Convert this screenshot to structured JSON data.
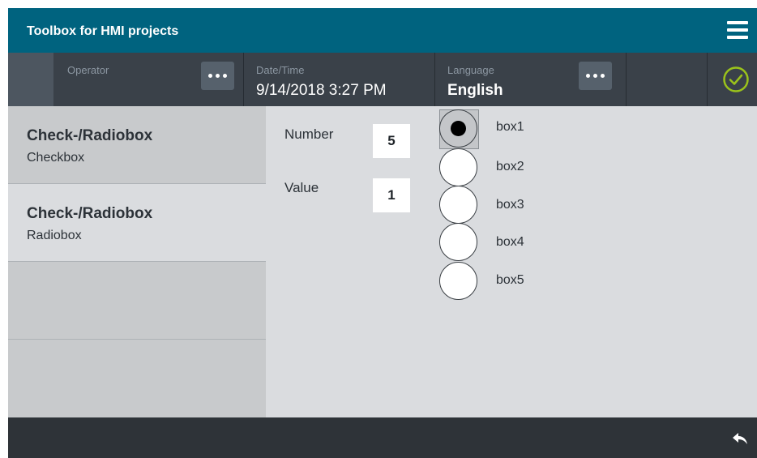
{
  "header": {
    "title": "Toolbox for HMI projects",
    "menu_icon": "hamburger-menu-icon"
  },
  "infobar": {
    "operator_label": "Operator",
    "datetime_label": "Date/Time",
    "datetime_value": "9/14/2018 3:27 PM",
    "language_label": "Language",
    "language_value": "English",
    "status_icon": "check-circle-icon",
    "status_color": "#9bc31b"
  },
  "sidebar": {
    "items": [
      {
        "label": "Check-/Radiobox",
        "sublabel": "Checkbox",
        "active": false
      },
      {
        "label": "Check-/Radiobox",
        "sublabel": "Radiobox",
        "active": true
      },
      {
        "label": "",
        "sublabel": "",
        "active": false
      },
      {
        "label": "",
        "sublabel": "",
        "active": false
      }
    ]
  },
  "main": {
    "number_label": "Number",
    "number_value": "5",
    "value_label": "Value",
    "value_value": "1",
    "radios": [
      {
        "label": "box1",
        "selected": true
      },
      {
        "label": "box2",
        "selected": false
      },
      {
        "label": "box3",
        "selected": false
      },
      {
        "label": "box4",
        "selected": false
      },
      {
        "label": "box5",
        "selected": false
      }
    ]
  },
  "footer": {
    "back_icon": "back-arrow-icon"
  }
}
